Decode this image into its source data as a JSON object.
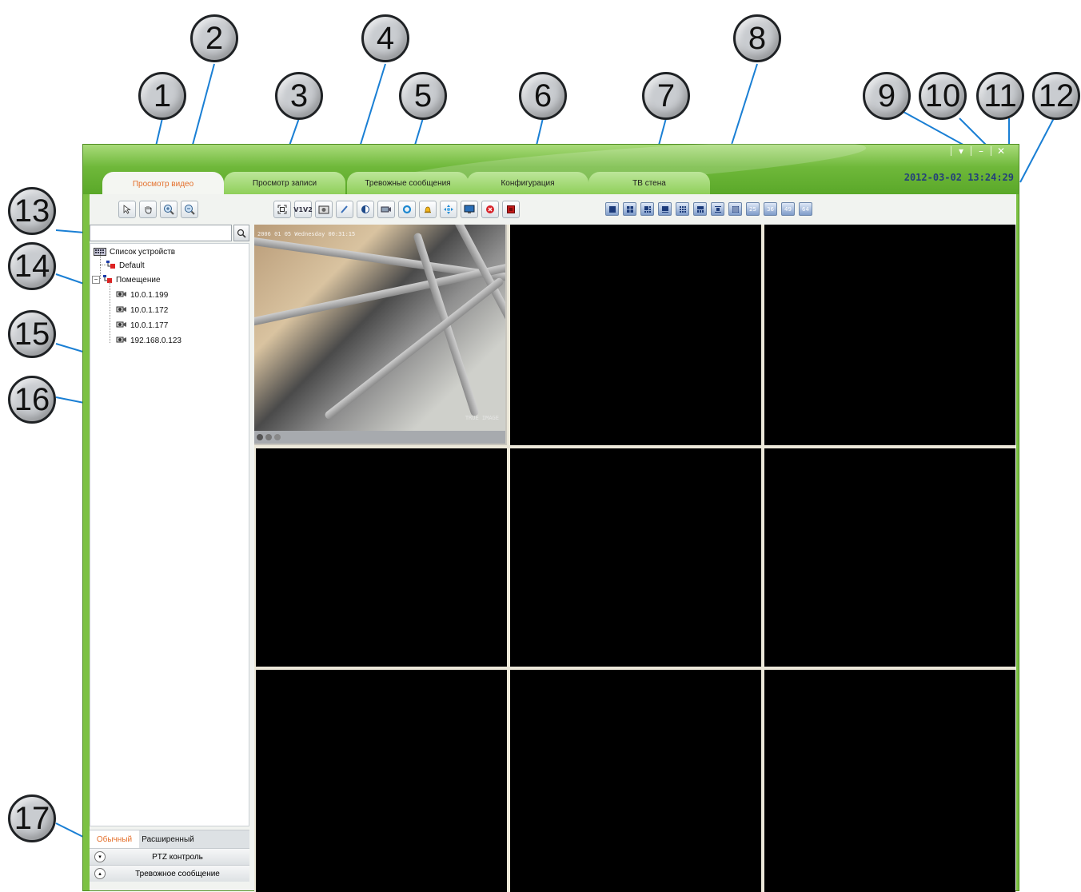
{
  "callouts": [
    "1",
    "2",
    "3",
    "4",
    "5",
    "6",
    "7",
    "8",
    "9",
    "10",
    "11",
    "12",
    "13",
    "14",
    "15",
    "16",
    "17"
  ],
  "window": {
    "datetime": "2012-03-02 13:24:29",
    "buttons": {
      "menu": "▾",
      "minimize": "–",
      "close": "✕"
    }
  },
  "tabs": [
    {
      "label": "Просмотр видео",
      "active": true
    },
    {
      "label": "Просмотр записи",
      "active": false
    },
    {
      "label": "Тревожные сообщения",
      "active": false
    },
    {
      "label": "Конфигурация",
      "active": false
    },
    {
      "label": "ТВ стена",
      "active": false
    }
  ],
  "left_toolbar": [
    "pointer-icon",
    "hand-icon",
    "zoom-in-icon",
    "zoom-out-icon"
  ],
  "video_toolbar": {
    "v1v2_label": "V1V2",
    "icons": [
      "fullscreen-icon",
      "v1v2-icon",
      "snapshot-icon",
      "brush-icon",
      "contrast-icon",
      "record-icon",
      "refresh-icon",
      "alarm-bell-icon",
      "ptz-icon",
      "monitor-icon",
      "stop-icon",
      "close-record-icon"
    ]
  },
  "layout_buttons": [
    "1",
    "4",
    "6",
    "8",
    "9",
    "10",
    "13",
    "16",
    "25",
    "36",
    "49",
    "64"
  ],
  "search": {
    "placeholder": ""
  },
  "tree": {
    "root": "Список устройств",
    "groups": [
      {
        "name": "Default"
      },
      {
        "name": "Помещение",
        "devices": [
          "10.0.1.199",
          "10.0.1.172",
          "10.0.1.177",
          "192.168.0.123"
        ]
      }
    ]
  },
  "bottom_tabs": {
    "normal": "Обычный",
    "extended": "Расширенный"
  },
  "accordion": {
    "ptz": "PTZ контроль",
    "alarm": "Тревожное сообщение"
  },
  "camera": {
    "osd": "2006 01 05 Wednesday 00:31:15",
    "watermark": "TRUE IMAGE"
  },
  "colors": {
    "frame_green": "#7cc143",
    "active_tab_text": "#e4702c",
    "datetime": "#24407a",
    "callout_line": "#1a7fd4"
  }
}
